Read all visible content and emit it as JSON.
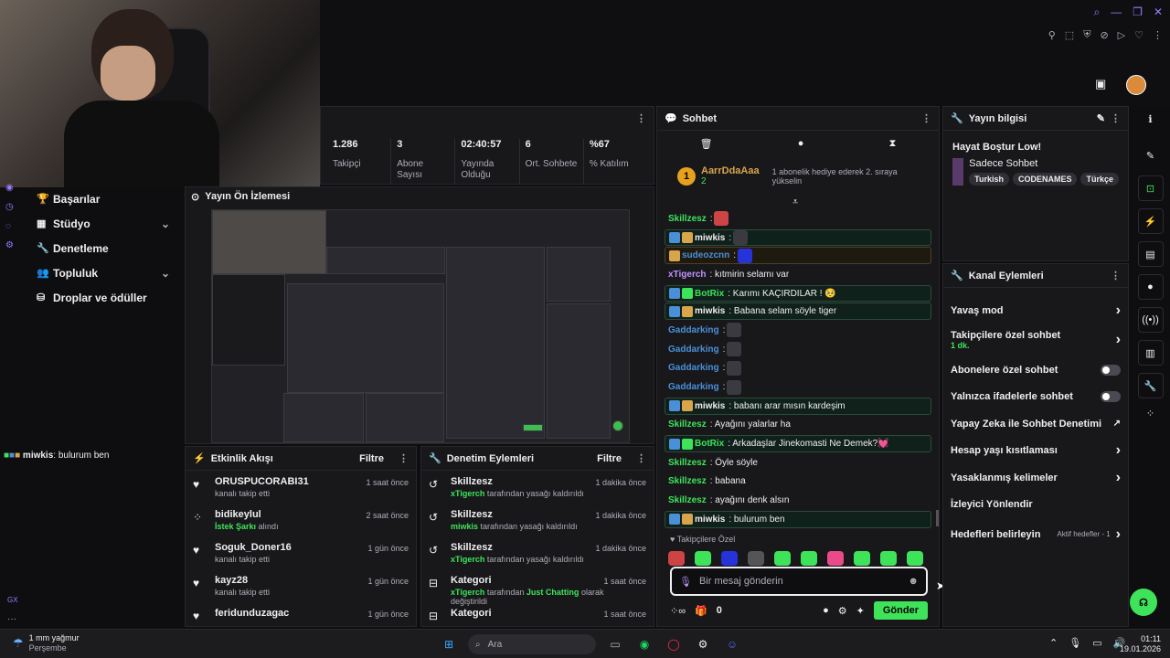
{
  "top": {
    "avatar_label": "avatar"
  },
  "stats": [
    {
      "value": "1.286",
      "label": "Takipçi"
    },
    {
      "value": "3",
      "label": "Abone Sayısı"
    },
    {
      "value": "02:40:57",
      "label": "Yayında Olduğu"
    },
    {
      "value": "6",
      "label": "Ort. Sohbete"
    },
    {
      "value": "%67",
      "label": "% Katılım"
    }
  ],
  "nav": [
    {
      "label": "Başarılar",
      "chevron": false
    },
    {
      "label": "Stüdyo",
      "chevron": true
    },
    {
      "label": "Denetleme",
      "chevron": false
    },
    {
      "label": "Topluluk",
      "chevron": true
    },
    {
      "label": "Droplar ve ödüller",
      "chevron": false
    }
  ],
  "overlay_chat": {
    "user": "miwkis",
    "text": ": bulurum ben"
  },
  "preview": {
    "title": "Yayın Ön İzlemesi"
  },
  "feed": {
    "title": "Etkinlik Akışı",
    "filter": "Filtre",
    "rows": [
      {
        "name": "ORUSPUCORABI31",
        "sub": "kanalı takip etti",
        "hl": "",
        "time": "1 saat önce",
        "icon": "heart"
      },
      {
        "name": "bidikeylul",
        "sub": "alındı",
        "hl": "İstek Şarkı",
        "time": "2 saat önce",
        "icon": "points"
      },
      {
        "name": "Soguk_Doner16",
        "sub": "kanalı takip etti",
        "hl": "",
        "time": "1 gün önce",
        "icon": "heart"
      },
      {
        "name": "kayz28",
        "sub": "kanalı takip etti",
        "hl": "",
        "time": "1 gün önce",
        "icon": "heart"
      },
      {
        "name": "feridunduzagac",
        "sub": "",
        "hl": "",
        "time": "1 gün önce",
        "icon": "heart"
      }
    ]
  },
  "mod": {
    "title": "Denetim Eylemleri",
    "filter": "Filtre",
    "rows": [
      {
        "name": "Skillzesz",
        "actor": "xTigerch",
        "sub": "tarafından yasağı kaldırıldı",
        "time": "1 dakika önce"
      },
      {
        "name": "Skillzesz",
        "actor": "miwkis",
        "sub": "tarafından yasağı kaldırıldı",
        "time": "1 dakika önce"
      },
      {
        "name": "Skillzesz",
        "actor": "xTigerch",
        "sub": "tarafından yasağı kaldırıldı",
        "time": "1 dakika önce"
      },
      {
        "name": "Kategori",
        "actor": "xTigerch",
        "sub": "tarafından",
        "extra": "Just Chatting",
        "extra2": "olarak değiştirildi",
        "time": "1 saat önce"
      },
      {
        "name": "Kategori",
        "actor": "",
        "sub": "",
        "time": "1 saat önce"
      }
    ]
  },
  "chat": {
    "title": "Sohbet",
    "hype_user": "AarrDdaAaa",
    "hype_count": "2",
    "hype_rank": "1",
    "hype_text": "1 abonelik hediye ederek 2. sıraya yükselin",
    "messages": [
      {
        "user": "Skillzesz",
        "text": ":",
        "color": "#3ee35a",
        "style": "",
        "badges": [],
        "emote": "red"
      },
      {
        "user": "miwkis",
        "text": ":",
        "color": "#efeff1",
        "style": "hl",
        "badges": [
          "b",
          "y"
        ],
        "emote": "face"
      },
      {
        "user": "sudeozcnn",
        "text": ":",
        "color": "#4a90d9",
        "style": "hlo",
        "badges": [
          "y"
        ],
        "emote": "blue"
      },
      {
        "user": "xTigerch",
        "text": ": kıtmirin selamı var",
        "color": "#bf94ff",
        "style": "",
        "badges": [],
        "emote": ""
      },
      {
        "user": "BotRix",
        "text": ": Karımı KAÇIRDILAR ! 🥺",
        "color": "#3ee35a",
        "style": "hl",
        "badges": [
          "b",
          "g"
        ],
        "emote": ""
      },
      {
        "user": "miwkis",
        "text": ": Babana selam söyle tiger",
        "color": "#efeff1",
        "style": "hl",
        "badges": [
          "b",
          "y"
        ],
        "emote": ""
      },
      {
        "user": "Gaddarking",
        "text": ":",
        "color": "#4a90d9",
        "style": "",
        "badges": [],
        "emote": "face"
      },
      {
        "user": "Gaddarking",
        "text": ":",
        "color": "#4a90d9",
        "style": "",
        "badges": [],
        "emote": "face"
      },
      {
        "user": "Gaddarking",
        "text": ":",
        "color": "#4a90d9",
        "style": "",
        "badges": [],
        "emote": "face"
      },
      {
        "user": "Gaddarking",
        "text": ":",
        "color": "#4a90d9",
        "style": "",
        "badges": [],
        "emote": "face"
      },
      {
        "user": "miwkis",
        "text": ": babanı arar mısın kardeşim",
        "color": "#efeff1",
        "style": "hl",
        "badges": [
          "b",
          "y"
        ],
        "emote": ""
      },
      {
        "user": "Skillzesz",
        "text": ": Ayağını yalarlar ha",
        "color": "#3ee35a",
        "style": "",
        "badges": [],
        "emote": ""
      },
      {
        "user": "BotRix",
        "text": ": Arkadaşlar Jinekomasti Ne Demek?💓",
        "color": "#3ee35a",
        "style": "hl",
        "badges": [
          "b",
          "g"
        ],
        "emote": ""
      },
      {
        "user": "Skillzesz",
        "text": ": Öyle söyle",
        "color": "#3ee35a",
        "style": "",
        "badges": [],
        "emote": ""
      },
      {
        "user": "Skillzesz",
        "text": ": babana",
        "color": "#3ee35a",
        "style": "",
        "badges": [],
        "emote": ""
      },
      {
        "user": "Skillzesz",
        "text": ": ayağını denk alsın",
        "color": "#3ee35a",
        "style": "",
        "badges": [],
        "emote": ""
      },
      {
        "user": "miwkis",
        "text": ": bulurum ben",
        "color": "#efeff1",
        "style": "hl",
        "badges": [
          "b",
          "y"
        ],
        "emote": ""
      }
    ],
    "followers_label": "Takipçilere Özel",
    "emote_colors": [
      "#c44",
      "#3ee35a",
      "#2633d9",
      "#555",
      "#3ee35a",
      "#3ee35a",
      "#e84a8a",
      "#3ee35a",
      "#3ee35a",
      "#3ee35a"
    ],
    "input_placeholder": "Bir mesaj gönderin",
    "points": "0",
    "send": "Gönder"
  },
  "info": {
    "title": "Yayın bilgisi",
    "stream_title": "Hayat Boştur Low!",
    "channel": "Sadece Sohbet",
    "tags": [
      "Turkish",
      "CODENAMES",
      "Türkçe"
    ]
  },
  "actions": {
    "title": "Kanal Eylemleri",
    "rows": [
      {
        "label": "Yavaş mod",
        "type": "chev",
        "sub": ""
      },
      {
        "label": "Takipçilere özel sohbet",
        "type": "chev",
        "sub": "1 dk."
      },
      {
        "label": "Abonelere özel sohbet",
        "type": "toggle",
        "sub": ""
      },
      {
        "label": "Yalnızca ifadelerle sohbet",
        "type": "toggle",
        "sub": ""
      },
      {
        "label": "Yapay Zeka ile Sohbet Denetimi",
        "type": "ext",
        "sub": ""
      },
      {
        "label": "Hesap yaşı kısıtlaması",
        "type": "chev",
        "sub": ""
      },
      {
        "label": "Yasaklanmış kelimeler",
        "type": "chev",
        "sub": ""
      },
      {
        "label": "İzleyici Yönlendir",
        "type": "none",
        "sub": ""
      },
      {
        "label": "Hedefleri belirleyin",
        "type": "goal",
        "sub": "Aktif hedefler - 1"
      }
    ]
  },
  "taskbar": {
    "weather": "1 mm yağmur",
    "day": "Perşembe",
    "search": "Ara",
    "time": "01:11",
    "date": "19.01.2026"
  },
  "colors": {
    "accent": "#3ee35a",
    "purple": "#9a7bff"
  }
}
